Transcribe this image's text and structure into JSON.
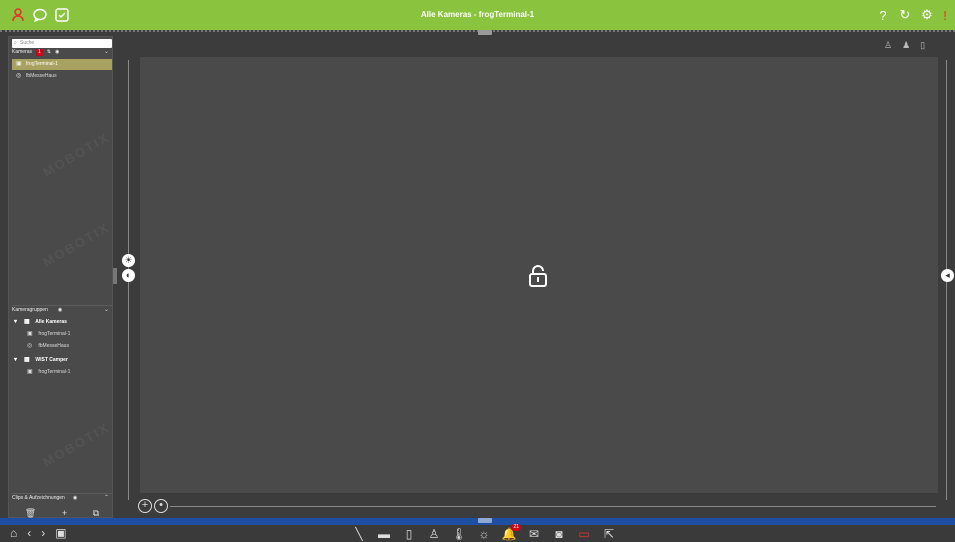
{
  "window": {
    "title": "Alle Kameras - frogTerminal-1"
  },
  "titlebar": {
    "left_icons": [
      "person-icon",
      "chat-icon",
      "check-icon"
    ],
    "right_icons": [
      "help-icon",
      "refresh-icon",
      "gear-icon",
      "power-icon"
    ]
  },
  "sidebar": {
    "search_placeholder": "Suche",
    "cameras_header": "Kameras",
    "cameras_badge": "1",
    "cameras": [
      {
        "label": "frogTerminal-1",
        "selected": true
      },
      {
        "label": "fbMesseHaus",
        "selected": false
      }
    ],
    "groups_header": "Kameragruppen",
    "groups": [
      {
        "label": "Alle Kameras",
        "children": [
          "frogTerminal-1",
          "fbMesseHaus"
        ]
      },
      {
        "label": "WIST Camper",
        "children": [
          "frogTerminal-1"
        ]
      }
    ],
    "clips_header": "Clips & Aufzeichnungen",
    "bottom_tools": [
      "trash-icon",
      "plus-icon",
      "export-icon"
    ]
  },
  "main": {
    "center_icon": "lock-icon"
  },
  "bottombar": {
    "left_icons": [
      "home-icon",
      "back-icon",
      "forward-icon",
      "screen-icon"
    ],
    "center_icons": [
      "wand-icon",
      "bar-icon",
      "door-icon",
      "person-icon",
      "thermometer-icon",
      "light-icon",
      "bell-icon",
      "mail-icon",
      "camera-icon",
      "record-icon",
      "export-icon"
    ],
    "bell_badge": "21"
  },
  "colors": {
    "titlebar": "#8ac43f",
    "accent_blue": "#1f4fa3",
    "selected": "#a8a261",
    "badge": "#d0021b"
  }
}
